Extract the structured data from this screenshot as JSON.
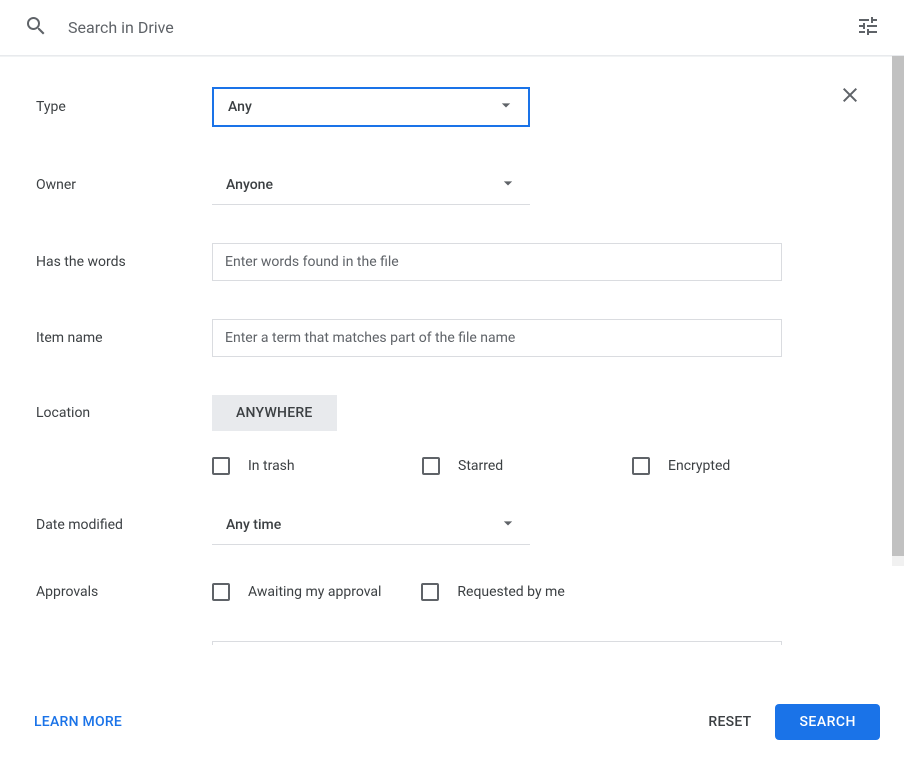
{
  "search": {
    "placeholder": "Search in Drive"
  },
  "form": {
    "type": {
      "label": "Type",
      "value": "Any"
    },
    "owner": {
      "label": "Owner",
      "value": "Anyone"
    },
    "hasWords": {
      "label": "Has the words",
      "placeholder": "Enter words found in the file"
    },
    "itemName": {
      "label": "Item name",
      "placeholder": "Enter a term that matches part of the file name"
    },
    "location": {
      "label": "Location",
      "value": "ANYWHERE"
    },
    "flags": {
      "inTrash": "In trash",
      "starred": "Starred",
      "encrypted": "Encrypted"
    },
    "dateModified": {
      "label": "Date modified",
      "value": "Any time"
    },
    "approvals": {
      "label": "Approvals",
      "awaiting": "Awaiting my approval",
      "requested": "Requested by me"
    }
  },
  "footer": {
    "learnMore": "Learn More",
    "reset": "Reset",
    "search": "Search"
  }
}
